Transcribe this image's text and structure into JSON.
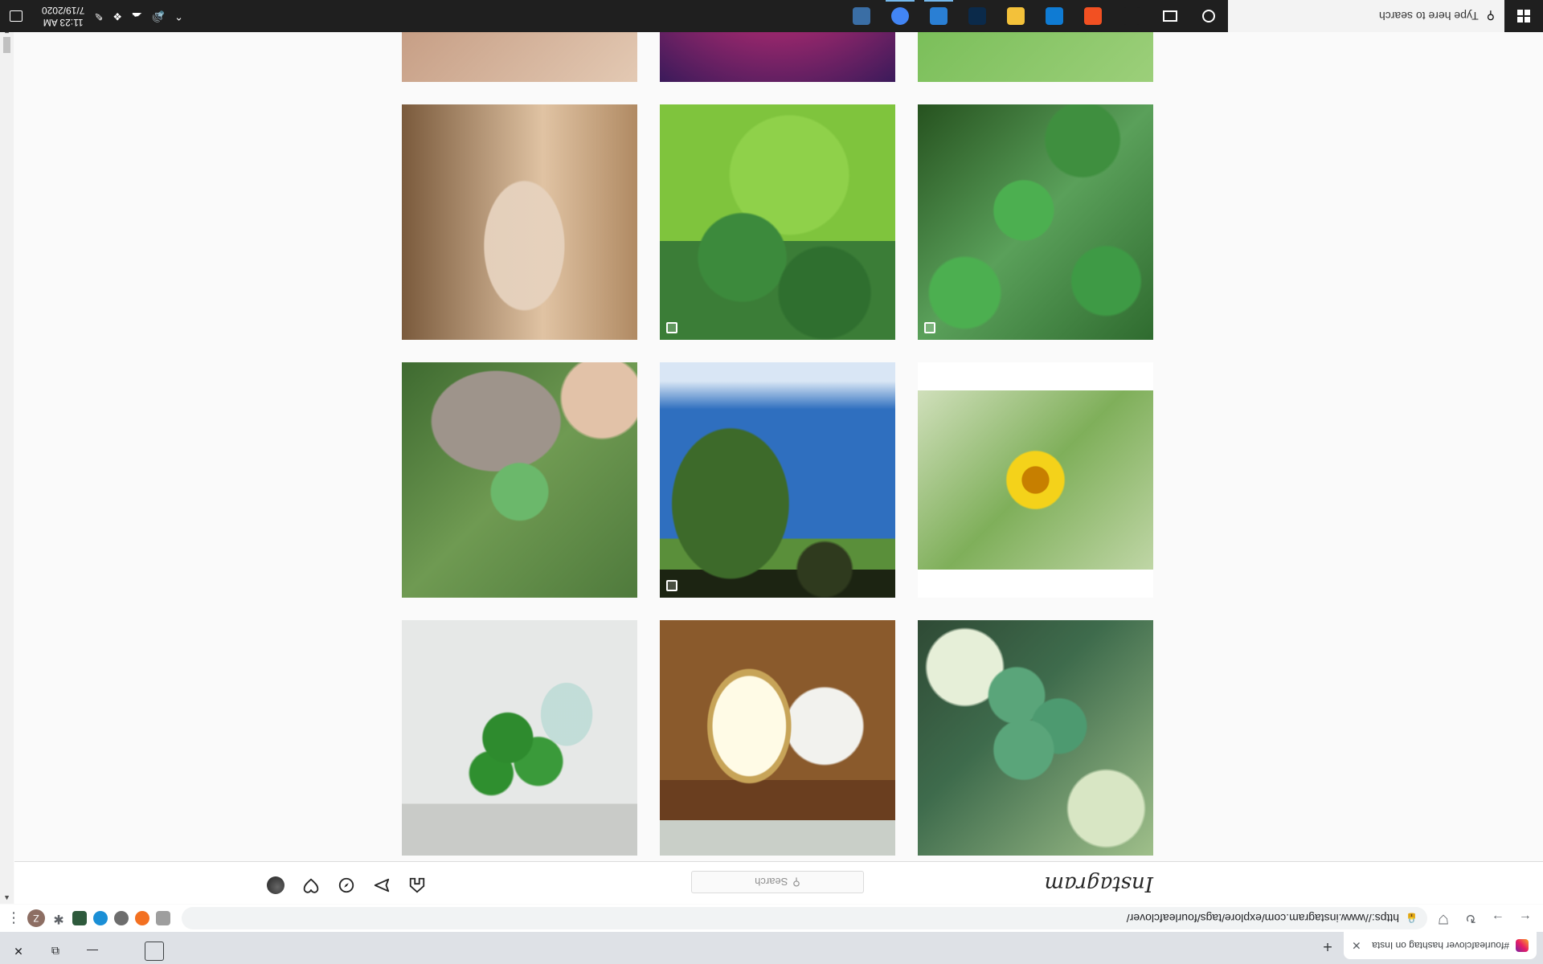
{
  "browser": {
    "tab_title": "#fourleafclover hashtag on Insta",
    "tab_close": "✕",
    "new_tab": "+",
    "url": "https://www.instagram.com/explore/tags/fourleafclover/",
    "profile_letter": "Z",
    "window_controls": {
      "minimize": "—",
      "restore": "⧉",
      "close": "✕"
    }
  },
  "instagram": {
    "logo": "Instagram",
    "search_placeholder": "Search",
    "search_icon": "search-icon",
    "posts": [
      {
        "style": "p-clover-dark",
        "multi": false
      },
      {
        "style": "p-frame",
        "multi": false
      },
      {
        "style": "p-glass",
        "multi": false
      },
      {
        "style": "p-sunflower",
        "multi": false
      },
      {
        "style": "p-tractor",
        "multi": true
      },
      {
        "style": "p-dog",
        "multi": false
      },
      {
        "style": "p-ground",
        "multi": true
      },
      {
        "style": "p-bigclover",
        "multi": true
      },
      {
        "style": "p-atlas",
        "multi": false
      },
      {
        "style": "p-paper",
        "multi": false
      },
      {
        "style": "p-pink",
        "multi": false
      },
      {
        "style": "p-hand",
        "multi": false
      }
    ]
  },
  "taskbar": {
    "search_placeholder": "Type here to search",
    "time": "11:23 AM",
    "date": "7/19/2020",
    "apps": [
      {
        "name": "task-view",
        "color": "#1f1f1f"
      },
      {
        "name": "microsoft-store",
        "color": "#f25022"
      },
      {
        "name": "edge",
        "color": "#0f7bd3"
      },
      {
        "name": "file-explorer",
        "color": "#f3c13a"
      },
      {
        "name": "photoshop",
        "color": "#0b2a4a"
      },
      {
        "name": "photos",
        "color": "#2a7fd4"
      },
      {
        "name": "chrome",
        "color": "#4285f4"
      },
      {
        "name": "settings",
        "color": "#3a6ea5"
      }
    ]
  }
}
